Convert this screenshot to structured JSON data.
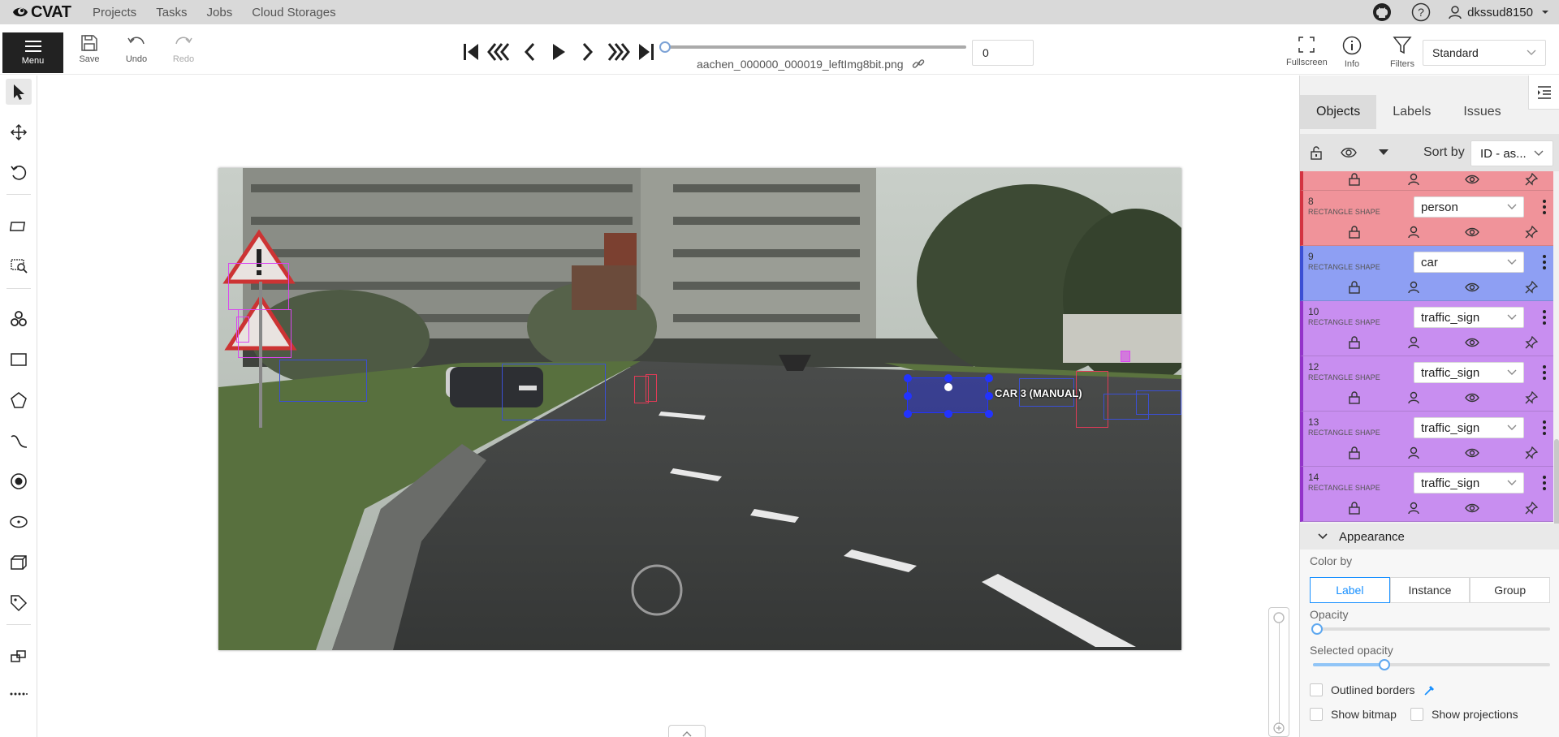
{
  "header": {
    "logo": "CVAT",
    "nav": [
      "Projects",
      "Tasks",
      "Jobs",
      "Cloud Storages"
    ],
    "username": "dkssud8150"
  },
  "toolbar": {
    "menu_label": "Menu",
    "save_label": "Save",
    "undo_label": "Undo",
    "redo_label": "Redo",
    "filename": "aachen_000000_000019_leftImg8bit.png",
    "frame_value": "0",
    "frame_progress": 0,
    "fullscreen_label": "Fullscreen",
    "info_label": "Info",
    "filters_label": "Filters",
    "workspace": "Standard"
  },
  "canvas": {
    "selected_label": "CAR 3 (MANUAL)"
  },
  "sidebar": {
    "tabs": [
      "Objects",
      "Labels",
      "Issues"
    ],
    "sort_by_label": "Sort by",
    "sort_value": "ID - as...",
    "objects": [
      {
        "id": "8",
        "type": "RECTANGLE SHAPE",
        "label": "person",
        "color": "#f0939a",
        "accent": "#d33341"
      },
      {
        "id": "9",
        "type": "RECTANGLE SHAPE",
        "label": "car",
        "color": "#8e9ff3",
        "accent": "#3b4fd4"
      },
      {
        "id": "10",
        "type": "RECTANGLE SHAPE",
        "label": "traffic_sign",
        "color": "#c88ef0",
        "accent": "#9333c9"
      },
      {
        "id": "12",
        "type": "RECTANGLE SHAPE",
        "label": "traffic_sign",
        "color": "#c88ef0",
        "accent": "#9333c9"
      },
      {
        "id": "13",
        "type": "RECTANGLE SHAPE",
        "label": "traffic_sign",
        "color": "#c88ef0",
        "accent": "#9333c9"
      },
      {
        "id": "14",
        "type": "RECTANGLE SHAPE",
        "label": "traffic_sign",
        "color": "#c88ef0",
        "accent": "#9333c9"
      }
    ],
    "appearance": {
      "title": "Appearance",
      "color_by_label": "Color by",
      "color_by_options": [
        "Label",
        "Instance",
        "Group"
      ],
      "color_by_selected": "Label",
      "opacity_label": "Opacity",
      "opacity_value": 0,
      "selected_opacity_label": "Selected opacity",
      "selected_opacity_value": 0.3,
      "outlined_borders_label": "Outlined borders",
      "show_bitmap_label": "Show bitmap",
      "show_projections_label": "Show projections"
    }
  }
}
